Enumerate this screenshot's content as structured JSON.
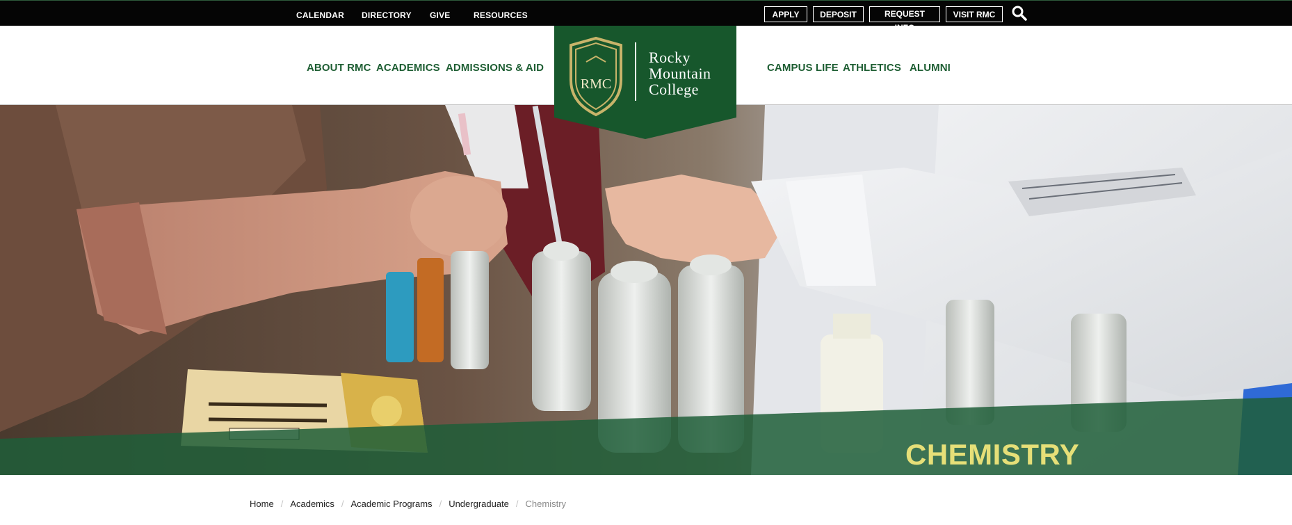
{
  "utility_nav": {
    "links": [
      "CALENDAR",
      "DIRECTORY",
      "GIVE",
      "RESOURCES"
    ],
    "buttons": [
      "APPLY",
      "DEPOSIT",
      "REQUEST INFO",
      "VISIT RMC"
    ],
    "search_icon": "search-icon"
  },
  "main_nav": {
    "left": [
      "ABOUT RMC",
      "ACADEMICS",
      "ADMISSIONS & AID"
    ],
    "right": [
      "CAMPUS LIFE",
      "ATHLETICS",
      "ALUMNI"
    ]
  },
  "logo": {
    "monogram": "RMC",
    "line1": "Rocky",
    "line2": "Mountain",
    "line3": "College"
  },
  "hero": {
    "title": "CHEMISTRY"
  },
  "breadcrumb": {
    "items": [
      "Home",
      "Academics",
      "Academic Programs",
      "Undergraduate"
    ],
    "current": "Chemistry",
    "separator": "/"
  },
  "colors": {
    "brand_green": "#17572c",
    "nav_green": "#1e5e33",
    "title_yellow": "#e6df78",
    "gold": "#c8b46a",
    "utility_black": "#050505"
  }
}
